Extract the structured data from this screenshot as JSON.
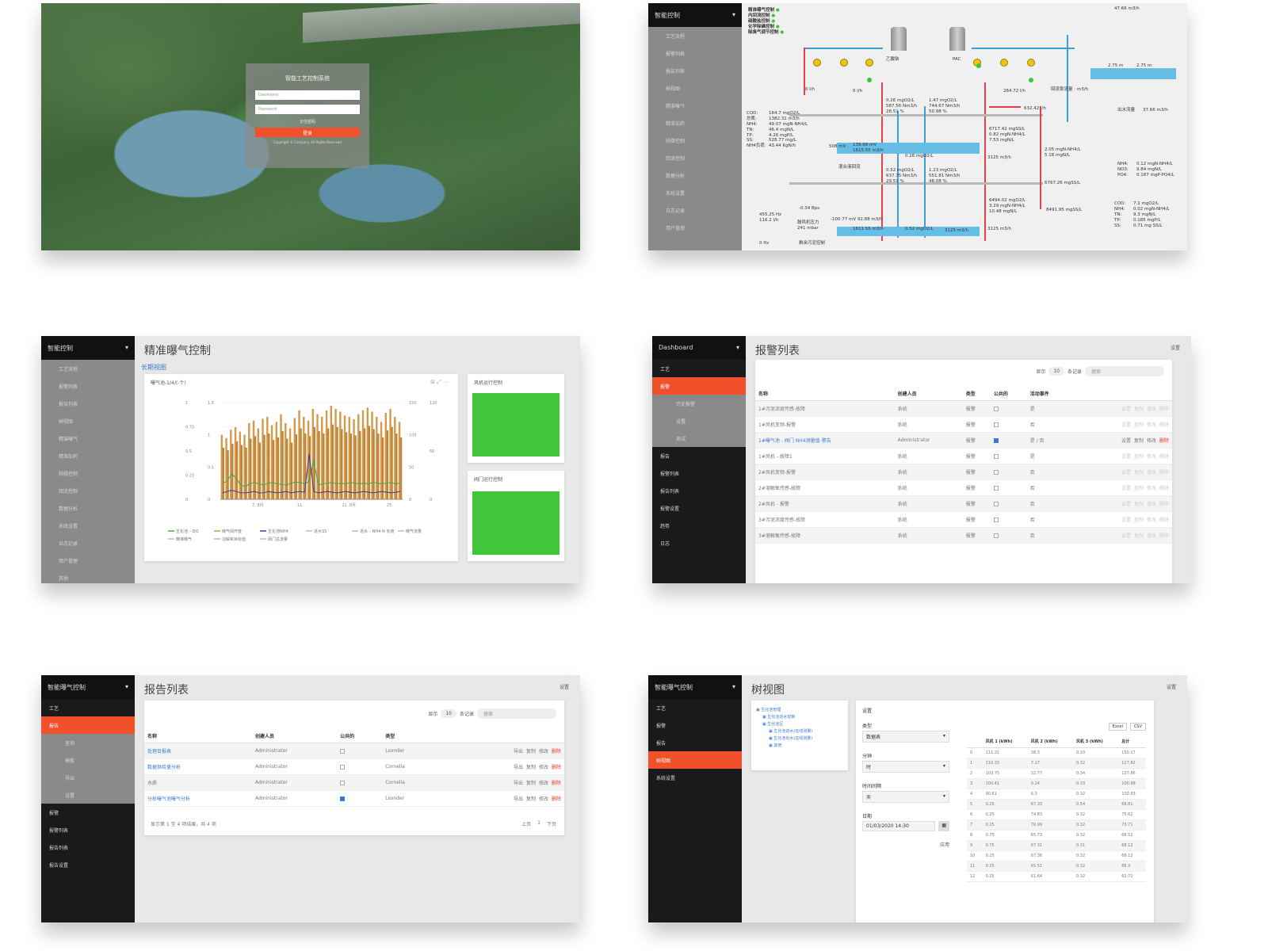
{
  "colors": {
    "accent": "#f0502a",
    "sidebar_dark": "#1a1a1a",
    "sidebar_grey": "#8a8a8a",
    "status_green": "#42c73a",
    "pipe_red": "#e2404a",
    "pipe_blue": "#3aa0d8"
  },
  "login": {
    "title": "智能工艺控制系统",
    "username_placeholder": "Username",
    "password_placeholder": "Password",
    "remember": "记住密码",
    "login_button": "登录",
    "footer": "Copyright © Company. All Rights Reserved"
  },
  "process": {
    "side_title": "智能控制",
    "side_items": [
      "工艺流程",
      "报警列表",
      "报告列表",
      "树视图",
      "精准曝气",
      "精准加药",
      "除磷控制",
      "回流控制",
      "数据分析",
      "系统设置",
      "日志记录",
      "用户管理"
    ],
    "legend": [
      "精准曝气控制",
      "内回流控制",
      "硝酸盐控制",
      "化学除磷控制",
      "除臭气调节控制"
    ],
    "labels": {
      "flow_top": "47.66 m3/h",
      "tank1": "乙酸钠",
      "tank2": "PAC",
      "flow1": "0 l/h",
      "flow2": "0 l/h",
      "flow3": "264.72 l/h",
      "flow4": "632.42 l/h",
      "inlet": "COD:\n总氮:\nNH4:\nTN:\nTP:\nSS:\nNH4负荷:",
      "inlet_vals": "164.7 mgO2/L\n1382.32 m3/h\n49.07 mgN-NH4/L\n46.4 mgN/L\n4.26 mgP/L\n528.77 mg/L\n43.44 KgN/h",
      "a1": "0.26 mgO2/L\n587.56 Nm3/h\n28.51 %",
      "a2": "1.47 mgO2/L\n744.67 Nm3/h\n50.98 %",
      "orp": "508 mV",
      "orp2": "139.68 mV\n1615.55 m3/h",
      "o3": "0.26 mgO2/L",
      "a3": "0.52 mgO2/L\n637.75 Nm3/h\n29.51 %",
      "a4": "1.23 mgO2/L\n551.81 Nm3/h\n48.08 %",
      "s1": "6717.42 mgSS/L\n0.82 mgN-NH4/L\n7.53 mgN/L",
      "s2": "3125 m3/h",
      "s3": "2.05 mgN-NH4/L\n5.18 mgN/L",
      "s4": "6767.26 mgSS/L",
      "s5": "6494.02 mgO2/L\n3.29 mgN-NH4/L\n10.48 mgN/L",
      "s6": "3125 m3/h",
      "s7": "8491.95 mgSS/L",
      "out1": "NH4:\nNO3:\nPO4:",
      "out1v": "0.12 mgN-NH4/L\n9.84 mgN/L\n0.187 mgP-PO4/L",
      "out2": "COD:\nNH4:\nTN:\nTP:\nSS:",
      "out2v": "7.1 mgO2/L\n0.02 mgN-NH4/L\n9.3 mgN/L\n0.185 mgP/L\n0.71 mg SS/L",
      "bl1": "455.25 Hz\n116.2 l/h",
      "bl2": "-0.34 Bps",
      "bl3": "-100.77 mV 92.88 m3/h",
      "bl4": "1611.55 m3/h",
      "bl5": "0.52 mgO2/L",
      "bl6": "3125 m3/h",
      "press": "鼓风机压力\n241 mbar",
      "zero": "0 Hz",
      "extra": "剩余污泥控制",
      "lvl1": "2.75 m",
      "lvl2": "2.75 m",
      "flowout": "出水流量",
      "flowout_v": "37.66 m3/h",
      "mixer": "混合液回流",
      "recirc": "回流泵流量 : m3/h"
    }
  },
  "aeration": {
    "page_title": "精准曝气控制",
    "tab": "长期视图",
    "chart_title": "曝气池-1/4/(-个)",
    "card2_title": "风机运行控制",
    "card3_title": "阀门运行控制",
    "side_items": [
      "工艺流程",
      "报警列表",
      "报告列表",
      "树视图",
      "精准曝气",
      "精准加药",
      "除磷控制",
      "回流控制",
      "数据分析",
      "系统设置",
      "日志记录",
      "用户管理",
      "其他"
    ]
  },
  "chart_data": {
    "type": "bar",
    "title": "",
    "xlabel": "",
    "ylabel": "",
    "x_ticks": [
      "7. 8月",
      "11.",
      "21. 8月",
      "25."
    ],
    "y_left_ticks": [
      "0",
      "0.25",
      "0.5",
      "0.75",
      "1"
    ],
    "y_left2_ticks": [
      "0",
      "0.5",
      "1",
      "1.5"
    ],
    "y_right_ticks": [
      "0",
      "50",
      "100",
      "150"
    ],
    "y_right2_ticks": [
      "0",
      "60",
      "120"
    ],
    "ylim": [
      0,
      150
    ],
    "series": [
      {
        "name": "",
        "type": "bar",
        "values": [
          100,
          95,
          108,
          112,
          105,
          100,
          118,
          122,
          110,
          125,
          128,
          115,
          120,
          132,
          118,
          110,
          126,
          138,
          128,
          122,
          140,
          132,
          128,
          138,
          145,
          140,
          136,
          130,
          128,
          124,
          132,
          138,
          142,
          136,
          128,
          120,
          134,
          140,
          128,
          120
        ]
      },
      {
        "name": "",
        "type": "bar",
        "values": [
          80,
          76,
          86,
          90,
          84,
          80,
          94,
          98,
          88,
          100,
          102,
          92,
          96,
          106,
          94,
          88,
          101,
          110,
          102,
          98,
          112,
          106,
          102,
          110,
          116,
          112,
          109,
          104,
          102,
          99,
          106,
          110,
          114,
          109,
          102,
          96,
          107,
          112,
          102,
          96
        ]
      },
      {
        "name": "",
        "type": "line",
        "values": [
          25,
          28,
          40,
          32,
          22,
          20,
          24,
          26,
          24,
          22,
          25,
          26,
          24,
          23,
          22,
          25,
          27,
          26,
          24,
          28,
          60,
          22,
          24,
          25,
          26,
          24,
          25,
          24,
          26,
          25,
          24,
          25,
          24,
          26,
          25,
          24,
          25,
          26,
          24,
          25
        ]
      },
      {
        "name": "",
        "type": "line",
        "values": [
          10,
          12,
          14,
          12,
          10,
          10,
          11,
          12,
          10,
          10,
          12,
          11,
          10,
          11,
          12,
          10,
          11,
          12,
          11,
          70,
          12,
          10,
          11,
          12,
          11,
          10,
          11,
          12,
          11,
          10,
          11,
          12,
          11,
          10,
          11,
          12,
          11,
          10,
          11,
          12
        ]
      }
    ],
    "legend": [
      "生化池 – DO",
      "曝气阀开度",
      "生化池NH4",
      "进水SS",
      "进水 – NH4-N 负荷",
      "曝气流量",
      "精准曝气",
      "溶解氧目标值",
      "阀门总流量"
    ]
  },
  "alarms": {
    "page_title": "报警列表",
    "setting": "设置",
    "filter": {
      "show": "显示",
      "per_page": "10",
      "records": "条记录",
      "search_placeholder": "搜索"
    },
    "columns": [
      "名称",
      "创建人员",
      "类型",
      "公共的",
      "活动事件"
    ],
    "rows": [
      {
        "name": "1#污泥浓度传感-故障",
        "user": "系统",
        "type": "报警",
        "public": false,
        "event": "是"
      },
      {
        "name": "1#风机变频-报警",
        "user": "系统",
        "type": "报警",
        "public": false,
        "event": "否"
      },
      {
        "name": "1#曝气池 - 阀门 NH4测量值-警告",
        "user": "Administrator",
        "type": "报警",
        "public": true,
        "event": "是 / 否"
      },
      {
        "name": "1#风机 - 故障1",
        "user": "系统",
        "type": "报警",
        "public": false,
        "event": "是"
      },
      {
        "name": "2#风机变频-报警",
        "user": "系统",
        "type": "报警",
        "public": false,
        "event": "否"
      },
      {
        "name": "2#溶解氧传感-故障",
        "user": "系统",
        "type": "报警",
        "public": false,
        "event": "否"
      },
      {
        "name": "2#风机 - 报警",
        "user": "系统",
        "type": "报警",
        "public": false,
        "event": "否"
      },
      {
        "name": "3#污泥浓度传感-故障",
        "user": "系统",
        "type": "报警",
        "public": false,
        "event": "否"
      },
      {
        "name": "3#溶解氧传感-故障",
        "user": "系统",
        "type": "报警",
        "public": false,
        "event": "否"
      }
    ],
    "actions": [
      "设置",
      "复制",
      "修改",
      "删除"
    ],
    "side": {
      "title": "Dashboard",
      "items": [
        "工艺",
        "报警",
        "报告",
        "报警列表",
        "报告列表",
        "报警设置",
        "趋势",
        "日志"
      ],
      "sub": [
        "历史报警",
        "设置",
        "测试"
      ],
      "active": "报警"
    }
  },
  "reports": {
    "page_title": "报告列表",
    "setting": "设置",
    "filter": {
      "show": "显示",
      "per_page": "10",
      "records": "条记录",
      "search_placeholder": "搜索"
    },
    "columns": [
      "名称",
      "创建人员",
      "公共的",
      "类型"
    ],
    "rows": [
      {
        "name": "处理日报表",
        "user": "Administrator",
        "public": false,
        "type": "Lsonder"
      },
      {
        "name": "数据供给量分析",
        "user": "Administrator",
        "public": false,
        "type": "Cornelia"
      },
      {
        "name": "水质",
        "user": "Administrator",
        "public": false,
        "type": "Cornelia"
      },
      {
        "name": "分析曝气池曝气分析",
        "user": "Administrator",
        "public": true,
        "type": "Lsonder"
      }
    ],
    "actions": [
      "导出",
      "复制",
      "修改",
      "删除"
    ],
    "footer": "显示第 1 至 4 项结果，共 4 项",
    "pager": [
      "上页",
      "1",
      "下页"
    ],
    "side": {
      "title": "智能曝气控制",
      "items": [
        "工艺",
        "报告",
        "报警",
        "报警列表",
        "报告列表",
        "报告设置"
      ],
      "sub": [
        "查询",
        "模板",
        "导出",
        "设置"
      ],
      "active": "报告"
    }
  },
  "tree": {
    "page_title": "树视图",
    "setting": "设置",
    "nodes": [
      "生化池管理",
      "生化池进水控制",
      "生化池区",
      "生化池进水(在线测量)",
      "生化池出水(在线测量)",
      "其他"
    ],
    "form": {
      "title": "设置",
      "type_label": "类型",
      "type_value": "数据表",
      "period_label": "分钟",
      "period_value": "时",
      "interval_label": "时间间隔",
      "interval_value": "天",
      "date_label": "日期",
      "date_value": "01/03/2020 14:30",
      "apply": "应用"
    },
    "buttons": [
      "Excel",
      "CSV"
    ],
    "columns": [
      "",
      "风机 1 (kWh)",
      "风机 2 (kWh)",
      "风机 3 (kWh)",
      "总计"
    ],
    "rows": [
      [
        "0",
        "111.31",
        "38.3",
        "0.33",
        "150.17"
      ],
      [
        "1",
        "110.33",
        "7.17",
        "0.32",
        "117.82"
      ],
      [
        "2",
        "103.75",
        "32.77",
        "0.34",
        "137.86"
      ],
      [
        "3",
        "100.41",
        "0.24",
        "0.33",
        "100.98"
      ],
      [
        "4",
        "90.61",
        "6.3",
        "0.32",
        "100.83"
      ],
      [
        "5",
        "0.25",
        "67.33",
        "0.54",
        "68.81"
      ],
      [
        "6",
        "0.25",
        "74.83",
        "0.32",
        "75.62"
      ],
      [
        "7",
        "0.25",
        "70.99",
        "0.32",
        "73.71"
      ],
      [
        "8",
        "0.75",
        "65.73",
        "0.32",
        "68.52"
      ],
      [
        "9",
        "0.75",
        "67.31",
        "0.31",
        "68.12"
      ],
      [
        "10",
        "0.25",
        "67.36",
        "0.32",
        "68.12"
      ],
      [
        "11",
        "0.25",
        "65.51",
        "0.32",
        "66.3"
      ],
      [
        "12",
        "0.25",
        "61.64",
        "0.32",
        "62.72"
      ]
    ],
    "side": {
      "title": "智能曝气控制",
      "items": [
        "工艺",
        "报警",
        "报告",
        "树视图",
        "系统设置"
      ],
      "active": "树视图"
    }
  }
}
